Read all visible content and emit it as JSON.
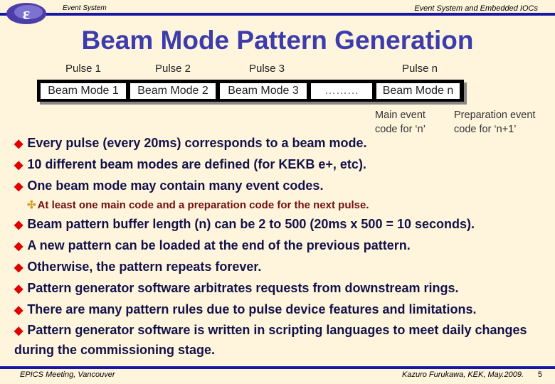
{
  "header": {
    "left_text": "Event System",
    "right_text": "Event System and Embedded IOCs",
    "logo_icon": "kek-e-logo-icon"
  },
  "title": "Beam Mode Pattern Generation",
  "diagram": {
    "pulses": [
      "Pulse 1",
      "Pulse 2",
      "Pulse 3",
      "Pulse n"
    ],
    "boxes": [
      "Beam Mode 1",
      "Beam Mode 2",
      "Beam Mode 3",
      "………",
      "Beam Mode n"
    ],
    "notes": {
      "main": [
        "Main event",
        "code for ‘n’"
      ],
      "prep": [
        "Preparation event",
        "code for ‘n+1’"
      ]
    }
  },
  "bullets": [
    "Every pulse (every 20ms) corresponds to a beam mode.",
    "10 different beam modes are defined (for KEKB e+, etc).",
    "One beam mode may contain many event codes."
  ],
  "sub_bullet": "At least one main code and a preparation code for the next pulse.",
  "bullets2": [
    "Beam pattern buffer length (n) can be 2 to 500 (20ms x 500 = 10 seconds).",
    "A new pattern can be loaded at the end of the previous pattern.",
    "Otherwise, the pattern repeats forever.",
    "Pattern generator software arbitrates requests from downstream rings.",
    "There are many pattern rules due to pulse device features and limitations.",
    "Pattern generator software is written in scripting languages to meet daily changes during the commissioning stage."
  ],
  "footer": {
    "left": "EPICS Meeting, Vancouver",
    "right": "Kazuro Furukawa, KEK, May.2009.",
    "page": "5"
  },
  "colors": {
    "background": "#fff4dc",
    "rule": "#1818a8",
    "title": "#3c3cac",
    "bullet_text": "#12124a",
    "bullet_marker": "#e00000",
    "sub_text": "#701010"
  }
}
